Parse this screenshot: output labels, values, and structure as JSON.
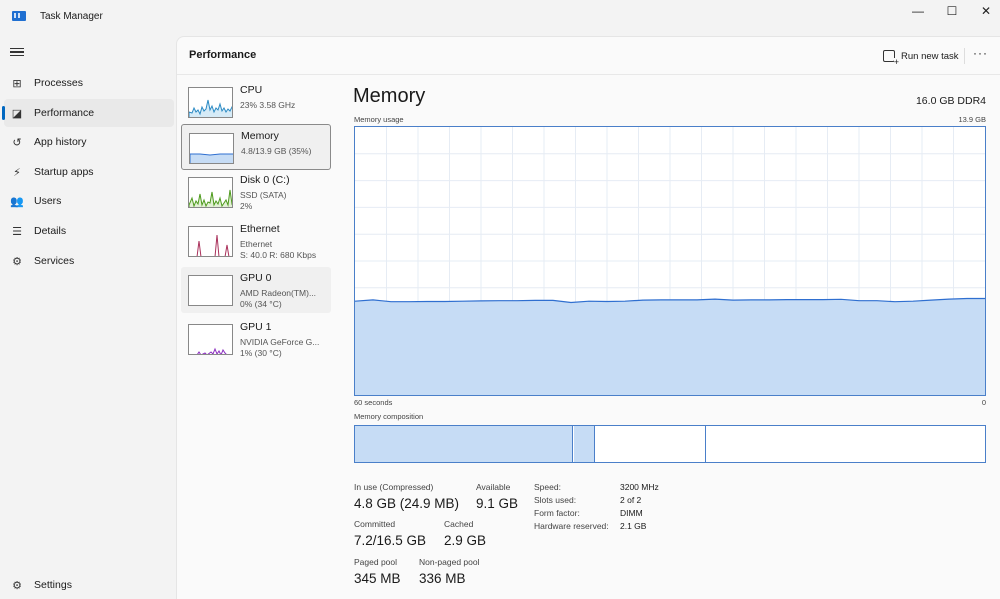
{
  "app": {
    "title": "Task Manager"
  },
  "window_controls": {
    "minimize": "—",
    "maximize": "☐",
    "close": "✕"
  },
  "sidebar": {
    "items": [
      {
        "label": "Processes",
        "icon": "processes-icon"
      },
      {
        "label": "Performance",
        "icon": "performance-icon",
        "active": true
      },
      {
        "label": "App history",
        "icon": "history-icon"
      },
      {
        "label": "Startup apps",
        "icon": "startup-icon"
      },
      {
        "label": "Users",
        "icon": "users-icon"
      },
      {
        "label": "Details",
        "icon": "details-icon"
      },
      {
        "label": "Services",
        "icon": "services-icon"
      }
    ],
    "settings": "Settings"
  },
  "header": {
    "title": "Performance",
    "run_new_task": "Run new task",
    "more": "···"
  },
  "devices": [
    {
      "name": "CPU",
      "line1": "23%  3.58 GHz",
      "line2": "",
      "color": "#2b8ac4"
    },
    {
      "name": "Memory",
      "line1": "4.8/13.9 GB (35%)",
      "line2": "",
      "color": "#2f6fd0",
      "selected": true
    },
    {
      "name": "Disk 0 (C:)",
      "line1": "SSD (SATA)",
      "line2": "2%",
      "color": "#4d9a1c"
    },
    {
      "name": "Ethernet",
      "line1": "Ethernet",
      "line2": "S: 40.0  R: 680 Kbps",
      "color": "#a9305a"
    },
    {
      "name": "GPU 0",
      "line1": "AMD Radeon(TM)...",
      "line2": "0%  (34 °C)",
      "color": "#8a2cbf"
    },
    {
      "name": "GPU 1",
      "line1": "NVIDIA GeForce G...",
      "line2": "1%  (30 °C)",
      "color": "#8a2cbf"
    }
  ],
  "detail": {
    "title": "Memory",
    "spec": "16.0 GB DDR4",
    "usage_label": "Memory usage",
    "usage_max": "13.9 GB",
    "time_left": "60 seconds",
    "time_right": "0",
    "composition_label": "Memory composition",
    "usage_series": [
      0.35,
      0.355,
      0.348,
      0.348,
      0.349,
      0.349,
      0.35,
      0.351,
      0.352,
      0.352,
      0.353,
      0.353,
      0.345,
      0.35,
      0.349,
      0.35,
      0.354,
      0.355,
      0.355,
      0.355,
      0.358,
      0.354,
      0.355,
      0.355,
      0.356,
      0.356,
      0.356,
      0.357,
      0.352,
      0.352,
      0.348,
      0.35,
      0.354,
      0.358,
      0.36,
      0.36
    ]
  },
  "stats": {
    "in_use_label": "In use (Compressed)",
    "in_use_value": "4.8 GB (24.9 MB)",
    "available_label": "Available",
    "available_value": "9.1 GB",
    "committed_label": "Committed",
    "committed_value": "7.2/16.5 GB",
    "cached_label": "Cached",
    "cached_value": "2.9 GB",
    "paged_label": "Paged pool",
    "paged_value": "345 MB",
    "nonpaged_label": "Non-paged pool",
    "nonpaged_value": "336 MB"
  },
  "properties": [
    {
      "key": "Speed:",
      "value": "3200 MHz"
    },
    {
      "key": "Slots used:",
      "value": "2 of 2"
    },
    {
      "key": "Form factor:",
      "value": "DIMM"
    },
    {
      "key": "Hardware reserved:",
      "value": "2.1 GB"
    }
  ]
}
